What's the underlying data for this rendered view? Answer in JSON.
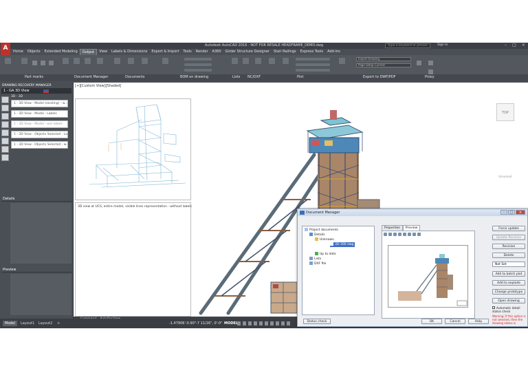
{
  "app": {
    "title": "Autodesk AutoCAD 2016 - NOT FOR RESALE   HEADFRAME_DEMO.dwg",
    "logo": "A",
    "search_placeholder": "Type a keyword or phrase",
    "sign_in": "Sign In"
  },
  "tabs": [
    "Home",
    "Objects",
    "Extended Modeling",
    "Output",
    "View",
    "Labels & Dimensions",
    "Export & Import",
    "Tools",
    "Render",
    "A360",
    "Girder Structure Designer",
    "Stair Railings",
    "Express Tools",
    "Add-ins"
  ],
  "ribbon": {
    "panels": [
      "Part marks",
      "Document Manager",
      "Documents",
      "BOM on drawing",
      "Lists",
      "NC/DXF",
      "Plot",
      "Export to DWF/PDF",
      "Proxy"
    ],
    "export_dropdown": "Export  Drawing",
    "page_setup_dropdown": "Page Setup  Current"
  },
  "left_panel": {
    "title": "DRAWING RECOVERY MANAGER",
    "header": "1 - GA 3D View",
    "subheader": "3D - 3D",
    "items": [
      "1 - 3D View - Model (existing) - w...",
      "1 - 3D View - Model - Labels",
      "1 - 3D View - Model - w/o labels",
      "1 - 3D View - Objects Selected - Labels",
      "1 - 3D View - Objects Selected - w..."
    ],
    "details_label": "Details",
    "preview_label": "Preview"
  },
  "viewport": {
    "label": "[+][Custom View][Shaded]",
    "thumb_caption": "3D view at UCS, entire model, visible lines representation - without labels",
    "viewcube": "TOP",
    "wcs": "Unnamed"
  },
  "command": {
    "history": "Command: _AutoDocView",
    "placeholder": "Type a command"
  },
  "status": {
    "tabs": [
      "Model",
      "Layout1",
      "Layout2"
    ],
    "add": "+",
    "coords": "-1.47906'-0.90\"-7 11/16\", 0'-0\"",
    "model": "MODEL"
  },
  "doc_manager": {
    "title": "Document Manager",
    "tree": [
      "Project documents",
      "Details",
      "Unknown",
      "3D-300.dwg",
      "Up to date",
      "Lists",
      "DXF file"
    ],
    "tabs": [
      "Properties",
      "Preview"
    ],
    "side_buttons": [
      "Force update",
      "Update Revision",
      "Revision",
      "Delete",
      "Add to batch plot",
      "Add to explode",
      "Change prototype",
      "Open drawing"
    ],
    "select_value": "Not Set",
    "checkbox_label": "Automatic detail status check",
    "warning": "Warning: If this option is not selected, then the drawing status is",
    "bottom_left": "Status check",
    "bottom_buttons": [
      "OK",
      "Cancel",
      "Help"
    ]
  },
  "colors": {
    "accent": "#c0302a",
    "frame_blue": "#4a82c0",
    "steel": "#6b7a86"
  }
}
